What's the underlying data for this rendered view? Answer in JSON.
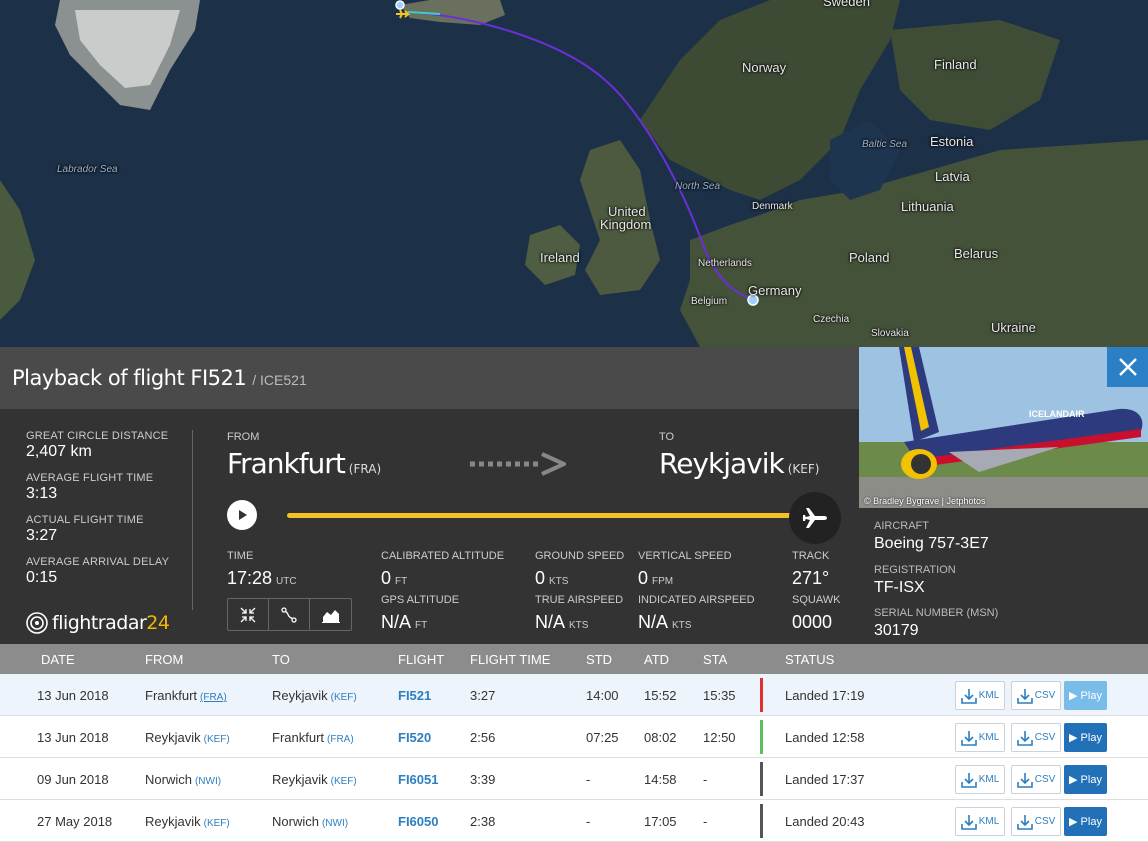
{
  "map": {
    "labels": {
      "sweden": "Sweden",
      "norway": "Norway",
      "finland": "Finland",
      "estonia": "Estonia",
      "latvia": "Latvia",
      "lithuania": "Lithuania",
      "belarus": "Belarus",
      "poland": "Poland",
      "ukraine": "Ukraine",
      "germany": "Germany",
      "czechia": "Czechia",
      "slovakia": "Slovakia",
      "denmark": "Denmark",
      "netherlands": "Netherlands",
      "belgium": "Belgium",
      "ireland": "Ireland",
      "uk_line1": "United",
      "uk_line2": "Kingdom",
      "labrador_sea": "Labrador Sea",
      "north_sea": "North Sea",
      "baltic_sea": "Baltic Sea"
    },
    "route_color": "#6b2fd6"
  },
  "header": {
    "title": "Playback of flight FI521",
    "subtitle": "/ ICE521"
  },
  "stats": [
    {
      "label": "GREAT CIRCLE DISTANCE",
      "value": "2,407 km"
    },
    {
      "label": "AVERAGE FLIGHT TIME",
      "value": "3:13"
    },
    {
      "label": "ACTUAL FLIGHT TIME",
      "value": "3:27"
    },
    {
      "label": "AVERAGE ARRIVAL DELAY",
      "value": "0:15"
    }
  ],
  "logo": {
    "text": "flightradar",
    "num": "24"
  },
  "route": {
    "from_label": "FROM",
    "from_city": "Frankfurt",
    "from_code": "(FRA)",
    "to_label": "TO",
    "to_city": "Reykjavik",
    "to_code": "(KEF)"
  },
  "playback": {
    "progress_percent": 100
  },
  "telemetry": {
    "time_label": "TIME",
    "time_value": "17:28",
    "time_unit": "UTC",
    "cal_alt_label": "CALIBRATED ALTITUDE",
    "cal_alt_value": "0",
    "cal_alt_unit": "FT",
    "gps_alt_label": "GPS ALTITUDE",
    "gps_alt_value": "N/A",
    "gps_alt_unit": "FT",
    "gs_label": "GROUND SPEED",
    "gs_value": "0",
    "gs_unit": "KTS",
    "tas_label": "TRUE AIRSPEED",
    "tas_value": "N/A",
    "tas_unit": "KTS",
    "vs_label": "VERTICAL SPEED",
    "vs_value": "0",
    "vs_unit": "FPM",
    "ias_label": "INDICATED AIRSPEED",
    "ias_value": "N/A",
    "ias_unit": "KTS",
    "track_label": "TRACK",
    "track_value": "271°",
    "squawk_label": "SQUAWK",
    "squawk_value": "0000"
  },
  "aircraft": {
    "photo_credit": "© Bradley Bygrave | Jetphotos",
    "livery_text": "ICELANDAIR",
    "aircraft_label": "AIRCRAFT",
    "aircraft_value": "Boeing 757-3E7",
    "reg_label": "REGISTRATION",
    "reg_value": "TF-ISX",
    "msn_label": "SERIAL NUMBER (MSN)",
    "msn_value": "30179"
  },
  "table": {
    "headers": [
      "DATE",
      "FROM",
      "TO",
      "FLIGHT",
      "FLIGHT TIME",
      "STD",
      "ATD",
      "STA",
      "STATUS"
    ],
    "kml_label": "KML",
    "csv_label": "CSV",
    "play_label": "▶ Play",
    "rows": [
      {
        "date": "13 Jun 2018",
        "from": "Frankfurt",
        "from_code": "(FRA)",
        "to": "Reykjavik",
        "to_code": "(KEF)",
        "flight": "FI521",
        "flight_time": "3:27",
        "std": "14:00",
        "atd": "15:52",
        "sta": "15:35",
        "status": "Landed 17:19",
        "status_color": "#e03131"
      },
      {
        "date": "13 Jun 2018",
        "from": "Reykjavik",
        "from_code": "(KEF)",
        "to": "Frankfurt",
        "to_code": "(FRA)",
        "flight": "FI520",
        "flight_time": "2:56",
        "std": "07:25",
        "atd": "08:02",
        "sta": "12:50",
        "status": "Landed 12:58",
        "status_color": "#5cc15c"
      },
      {
        "date": "09 Jun 2018",
        "from": "Norwich",
        "from_code": "(NWI)",
        "to": "Reykjavik",
        "to_code": "(KEF)",
        "flight": "FI6051",
        "flight_time": "3:39",
        "std": "-",
        "atd": "14:58",
        "sta": "-",
        "status": "Landed 17:37",
        "status_color": "#555555"
      },
      {
        "date": "27 May 2018",
        "from": "Reykjavik",
        "from_code": "(KEF)",
        "to": "Norwich",
        "to_code": "(NWI)",
        "flight": "FI6050",
        "flight_time": "2:38",
        "std": "-",
        "atd": "17:05",
        "sta": "-",
        "status": "Landed 20:43",
        "status_color": "#555555"
      }
    ]
  }
}
